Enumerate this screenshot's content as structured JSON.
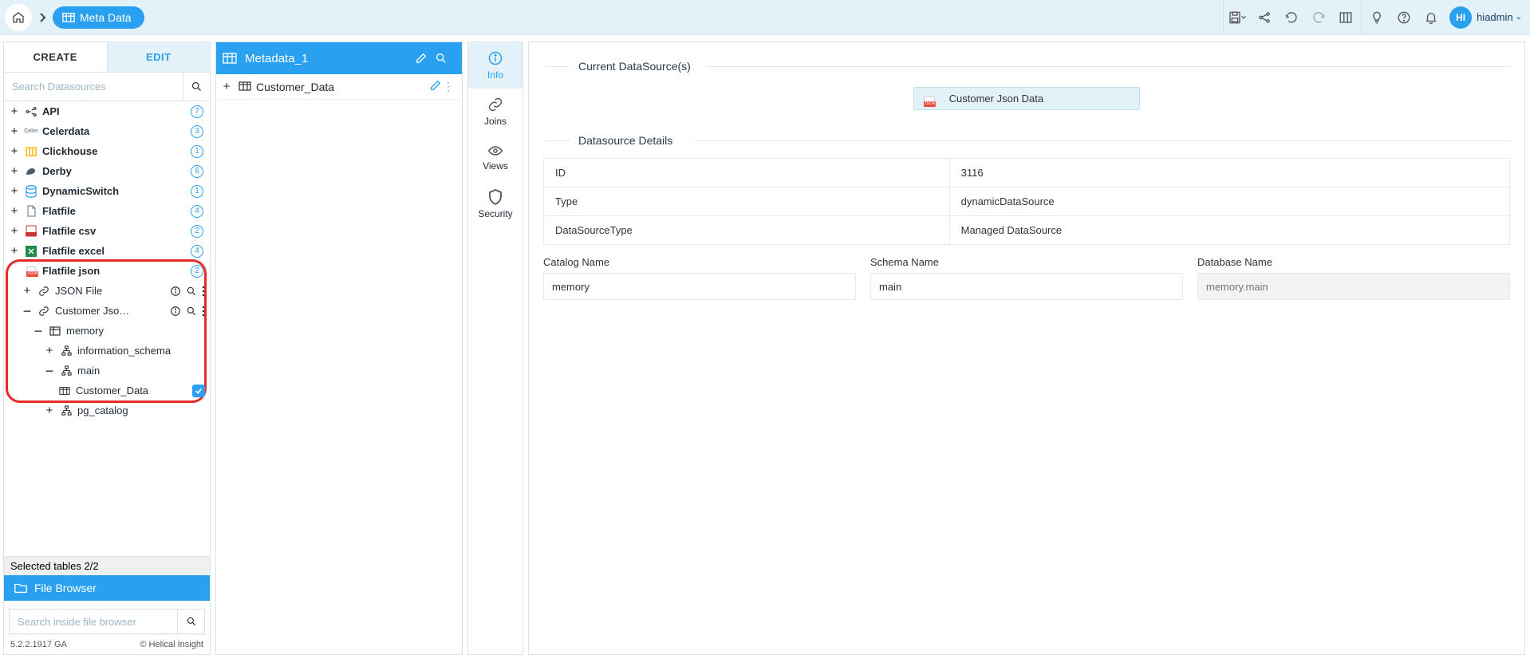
{
  "breadcrumb": {
    "label": "Meta Data"
  },
  "user": {
    "initials": "HI",
    "name": "hiadmin"
  },
  "sidebar": {
    "tabs": {
      "create": "CREATE",
      "edit": "EDIT"
    },
    "search_placeholder": "Search Datasources",
    "items": [
      {
        "label": "API",
        "count": "7"
      },
      {
        "label": "Celerdata",
        "count": "3"
      },
      {
        "label": "Clickhouse",
        "count": "1"
      },
      {
        "label": "Derby",
        "count": "6"
      },
      {
        "label": "DynamicSwitch",
        "count": "1"
      },
      {
        "label": "Flatfile",
        "count": "4"
      },
      {
        "label": "Flatfile csv",
        "count": "2"
      },
      {
        "label": "Flatfile excel",
        "count": "4"
      },
      {
        "label": "Flatfile json",
        "count": "2"
      }
    ],
    "json_children": {
      "json_file": "JSON File",
      "customer": "Customer Jso…",
      "memory": "memory",
      "info_schema": "information_schema",
      "main": "main",
      "table": "Customer_Data",
      "pg_catalog": "pg_catalog"
    },
    "selected_tables": "Selected tables 2/2",
    "file_browser": "File Browser",
    "fb_search_placeholder": "Search inside file browser",
    "version": "5.2.2.1917 GA",
    "copyright": "Helical Insight"
  },
  "metadata": {
    "title": "Metadata_1",
    "rows": [
      {
        "label": "Customer_Data"
      }
    ]
  },
  "nav": {
    "info": "Info",
    "joins": "Joins",
    "views": "Views",
    "security": "Security"
  },
  "detail": {
    "section_current": "Current DataSource(s)",
    "current_ds": "Customer Json Data",
    "section_details": "Datasource Details",
    "rows": {
      "id_label": "ID",
      "id_value": "3116",
      "type_label": "Type",
      "type_value": "dynamicDataSource",
      "dst_label": "DataSourceType",
      "dst_value": "Managed DataSource"
    },
    "catalog": {
      "label": "Catalog Name",
      "value": "memory"
    },
    "schema": {
      "label": "Schema Name",
      "value": "main"
    },
    "dbname": {
      "label": "Database Name",
      "placeholder": "memory.main"
    }
  }
}
